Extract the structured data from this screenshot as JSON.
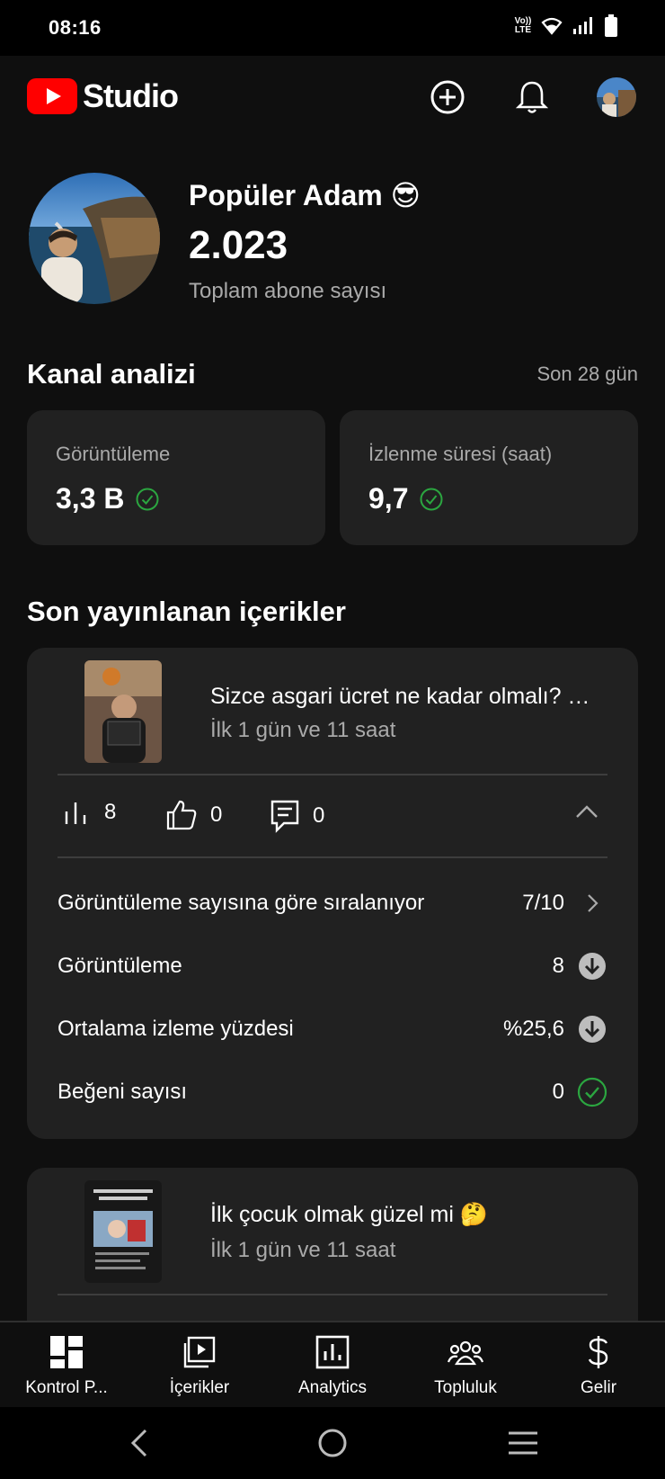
{
  "status": {
    "time": "08:16",
    "lte_top": "Vo))",
    "lte_bottom": "LTE"
  },
  "app": {
    "logo_text": "Studio",
    "brand_color": "#ff0000"
  },
  "channel": {
    "name": "Popüler Adam 😎",
    "subscribers": "2.023",
    "subscribers_label": "Toplam abone sayısı"
  },
  "analytics": {
    "title": "Kanal analizi",
    "range": "Son 28 gün",
    "cards": [
      {
        "label": "Görüntüleme",
        "value": "3,3 B"
      },
      {
        "label": "İzlenme süresi (saat)",
        "value": "9,7"
      }
    ]
  },
  "recent": {
    "title": "Son yayınlanan içerikler",
    "videos": [
      {
        "title": "Sizce asgari ücret ne kadar olmalı? …",
        "time": "İlk 1 gün ve 11 saat",
        "views": "8",
        "likes": "0",
        "comments": "0",
        "rank_label": "Görüntüleme sayısına göre sıralanıyor",
        "rank_value": "7/10",
        "metrics": [
          {
            "label": "Görüntüleme",
            "value": "8",
            "status": "down"
          },
          {
            "label": "Ortalama izleme yüzdesi",
            "value": "%25,6",
            "status": "down"
          },
          {
            "label": "Beğeni sayısı",
            "value": "0",
            "status": "ok"
          }
        ]
      },
      {
        "title": "İlk çocuk olmak güzel mi 🤔",
        "time": "İlk 1 gün ve 11 saat"
      }
    ]
  },
  "nav": [
    {
      "label": "Kontrol P...",
      "icon": "dashboard-icon"
    },
    {
      "label": "İçerikler",
      "icon": "content-icon"
    },
    {
      "label": "Analytics",
      "icon": "analytics-icon"
    },
    {
      "label": "Topluluk",
      "icon": "community-icon"
    },
    {
      "label": "Gelir",
      "icon": "dollar-icon"
    }
  ],
  "colors": {
    "ok": "#2ba640",
    "background": "#0f0f0f",
    "card": "#212121"
  }
}
